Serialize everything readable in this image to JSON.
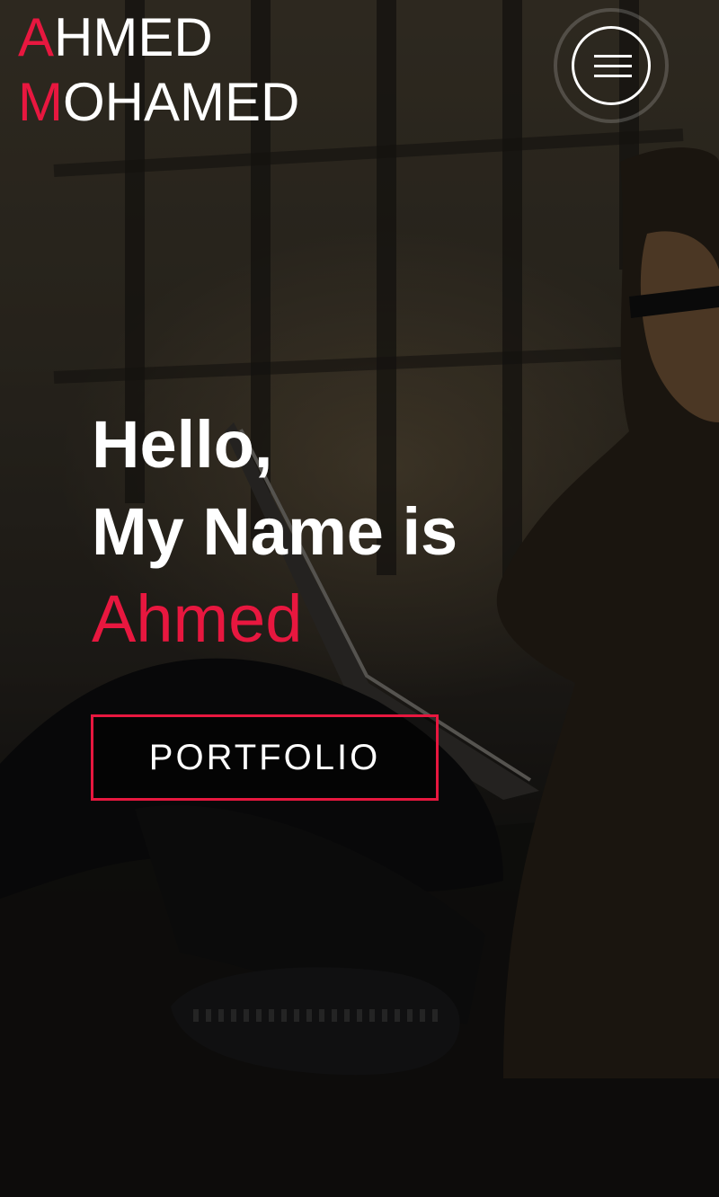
{
  "logo": {
    "line1_initial": "A",
    "line1_rest": "HMED",
    "line2_initial": "M",
    "line2_rest": "OHAMED"
  },
  "menu": {
    "icon": "hamburger-menu-icon"
  },
  "hero": {
    "greeting": "Hello,",
    "intro": "My Name is",
    "name": "Ahmed",
    "cta_label": "PORTFOLIO"
  },
  "colors": {
    "accent": "#e8173f",
    "text": "#ffffff"
  }
}
